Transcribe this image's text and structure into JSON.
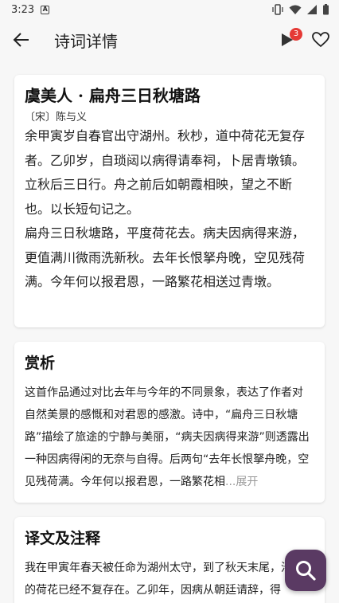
{
  "status_bar": {
    "time": "3:23",
    "a_icon": "A"
  },
  "header": {
    "title": "诗词详情",
    "badge_count": "3"
  },
  "poem": {
    "title": "虞美人 · 扁舟三日秋塘路",
    "author": "〔宋〕陈与义",
    "preface": "余甲寅岁自春官出守湖州。秋杪，道中荷花无复存者。乙卯岁，自琐闼以病得请奉祠，卜居青墩镇。立秋后三日行。舟之前后如朝霞相映，望之不断也。以长短句记之。",
    "verse": "扁舟三日秋塘路，平度荷花去。病夫因病得来游，更值满川微雨洗新秋。去年长恨拏舟晚，空见残荷满。今年何以报君恩，一路繁花相送过青墩。"
  },
  "appreciation": {
    "title": "赏析",
    "text": "这首作品通过对比去年与今年的不同景象，表达了作者对自然美景的感慨和对君恩的感激。诗中，“扁舟三日秋塘路”描绘了旅途的宁静与美丽，“病夫因病得来游”则透露出一种因病得闲的无奈与自得。后两句“去年长恨拏舟晚，空见残荷满。今年何以报君恩，一路繁花相",
    "ellipsis": "...",
    "expand_label": "展开"
  },
  "translation": {
    "title": "译文及注释",
    "text": "我在甲寅年春天被任命为湖州太守，到了秋天末尾，沿途的荷花已经不复存在。乙卯年，因病从朝廷请辞，得"
  },
  "icons": {
    "back": "arrow-left-icon",
    "play": "play-icon",
    "favorite": "heart-outline-icon",
    "search": "search-icon"
  },
  "colors": {
    "fab": "#5a3a63",
    "badge": "#e53935",
    "background": "#f7f7f7"
  }
}
